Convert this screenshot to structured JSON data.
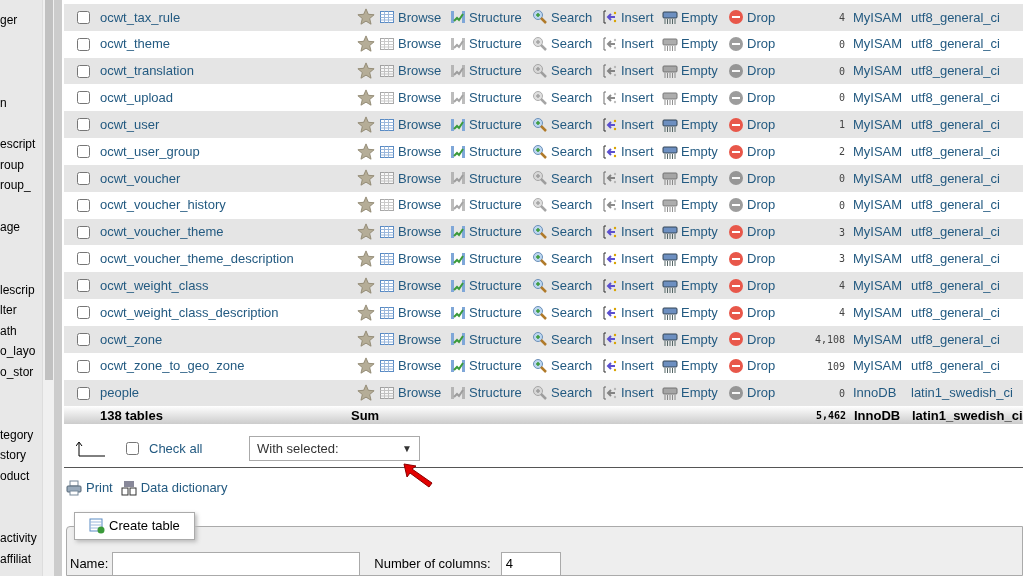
{
  "sidebar": {
    "groups": [
      [
        "ger"
      ],
      [
        "n"
      ],
      [
        "escript",
        "roup",
        "roup_"
      ],
      [
        "age"
      ],
      [
        "lescrip",
        "lter",
        "ath",
        "o_layo",
        "o_stor"
      ],
      [
        "tegory",
        "story",
        "oduct"
      ],
      [
        "activity",
        "affiliat"
      ]
    ]
  },
  "table": {
    "rows": [
      {
        "name": "ocwt_tax_rule",
        "checked": false,
        "active": true,
        "actions": [
          "Browse",
          "Structure",
          "Search",
          "Insert",
          "Empty",
          "Drop"
        ],
        "rows": "4",
        "engine": "MyISAM",
        "collation": "utf8_general_ci"
      },
      {
        "name": "ocwt_theme",
        "checked": false,
        "active": false,
        "actions": [
          "Browse",
          "Structure",
          "Search",
          "Insert",
          "Empty",
          "Drop"
        ],
        "rows": "0",
        "engine": "MyISAM",
        "collation": "utf8_general_ci"
      },
      {
        "name": "ocwt_translation",
        "checked": false,
        "active": false,
        "actions": [
          "Browse",
          "Structure",
          "Search",
          "Insert",
          "Empty",
          "Drop"
        ],
        "rows": "0",
        "engine": "MyISAM",
        "collation": "utf8_general_ci"
      },
      {
        "name": "ocwt_upload",
        "checked": false,
        "active": false,
        "actions": [
          "Browse",
          "Structure",
          "Search",
          "Insert",
          "Empty",
          "Drop"
        ],
        "rows": "0",
        "engine": "MyISAM",
        "collation": "utf8_general_ci"
      },
      {
        "name": "ocwt_user",
        "checked": false,
        "active": true,
        "actions": [
          "Browse",
          "Structure",
          "Search",
          "Insert",
          "Empty",
          "Drop"
        ],
        "rows": "1",
        "engine": "MyISAM",
        "collation": "utf8_general_ci"
      },
      {
        "name": "ocwt_user_group",
        "checked": false,
        "active": true,
        "actions": [
          "Browse",
          "Structure",
          "Search",
          "Insert",
          "Empty",
          "Drop"
        ],
        "rows": "2",
        "engine": "MyISAM",
        "collation": "utf8_general_ci"
      },
      {
        "name": "ocwt_voucher",
        "checked": false,
        "active": false,
        "actions": [
          "Browse",
          "Structure",
          "Search",
          "Insert",
          "Empty",
          "Drop"
        ],
        "rows": "0",
        "engine": "MyISAM",
        "collation": "utf8_general_ci"
      },
      {
        "name": "ocwt_voucher_history",
        "checked": false,
        "active": false,
        "actions": [
          "Browse",
          "Structure",
          "Search",
          "Insert",
          "Empty",
          "Drop"
        ],
        "rows": "0",
        "engine": "MyISAM",
        "collation": "utf8_general_ci"
      },
      {
        "name": "ocwt_voucher_theme",
        "checked": false,
        "active": true,
        "actions": [
          "Browse",
          "Structure",
          "Search",
          "Insert",
          "Empty",
          "Drop"
        ],
        "rows": "3",
        "engine": "MyISAM",
        "collation": "utf8_general_ci"
      },
      {
        "name": "ocwt_voucher_theme_description",
        "checked": false,
        "active": true,
        "actions": [
          "Browse",
          "Structure",
          "Search",
          "Insert",
          "Empty",
          "Drop"
        ],
        "rows": "3",
        "engine": "MyISAM",
        "collation": "utf8_general_ci"
      },
      {
        "name": "ocwt_weight_class",
        "checked": false,
        "active": true,
        "actions": [
          "Browse",
          "Structure",
          "Search",
          "Insert",
          "Empty",
          "Drop"
        ],
        "rows": "4",
        "engine": "MyISAM",
        "collation": "utf8_general_ci"
      },
      {
        "name": "ocwt_weight_class_description",
        "checked": false,
        "active": true,
        "actions": [
          "Browse",
          "Structure",
          "Search",
          "Insert",
          "Empty",
          "Drop"
        ],
        "rows": "4",
        "engine": "MyISAM",
        "collation": "utf8_general_ci"
      },
      {
        "name": "ocwt_zone",
        "checked": false,
        "active": true,
        "actions": [
          "Browse",
          "Structure",
          "Search",
          "Insert",
          "Empty",
          "Drop"
        ],
        "rows": "4,108",
        "engine": "MyISAM",
        "collation": "utf8_general_ci"
      },
      {
        "name": "ocwt_zone_to_geo_zone",
        "checked": false,
        "active": true,
        "actions": [
          "Browse",
          "Structure",
          "Search",
          "Insert",
          "Empty",
          "Drop"
        ],
        "rows": "109",
        "engine": "MyISAM",
        "collation": "utf8_general_ci"
      },
      {
        "name": "people",
        "checked": false,
        "active": false,
        "actions": [
          "Browse",
          "Structure",
          "Search",
          "Insert",
          "Empty",
          "Drop"
        ],
        "rows": "0",
        "engine": "InnoDB",
        "collation": "latin1_swedish_ci"
      }
    ],
    "footer": {
      "count": "138 tables",
      "label": "Sum",
      "rows": "5,462",
      "engine": "InnoDB",
      "collation": "latin1_swedish_ci"
    }
  },
  "bulk": {
    "check_all": {
      "label": "Check all",
      "checked": false
    },
    "select": {
      "value": "With selected:",
      "arrow": "▼"
    }
  },
  "links": [
    "Print",
    "Data dictionary"
  ],
  "create": {
    "tab": "Create table",
    "name_label": "Name:",
    "columns_label": "Number of columns:",
    "columns_value": "4"
  }
}
